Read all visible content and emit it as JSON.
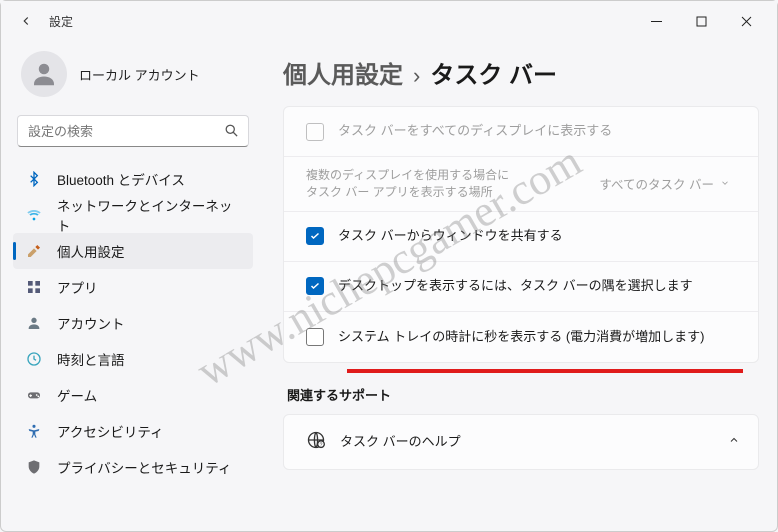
{
  "app_title": "設定",
  "account": {
    "name": "ローカル アカウント"
  },
  "search": {
    "placeholder": "設定の検索"
  },
  "sidebar": {
    "items": [
      {
        "label": "Bluetooth とデバイス",
        "icon": "bluetooth",
        "color": "#0067c0"
      },
      {
        "label": "ネットワークとインターネット",
        "icon": "wifi",
        "color": "#0aa2e3"
      },
      {
        "label": "個人用設定",
        "icon": "brush",
        "color": "#c55f1b",
        "active": true
      },
      {
        "label": "アプリ",
        "icon": "apps",
        "color": "#545a78"
      },
      {
        "label": "アカウント",
        "icon": "account",
        "color": "#6b7a85"
      },
      {
        "label": "時刻と言語",
        "icon": "clock-lang",
        "color": "#39a5bd"
      },
      {
        "label": "ゲーム",
        "icon": "game",
        "color": "#6e6e72"
      },
      {
        "label": "アクセシビリティ",
        "icon": "accessibility",
        "color": "#2f6db1"
      },
      {
        "label": "プライバシーとセキュリティ",
        "icon": "privacy",
        "color": "#6e6e72"
      }
    ]
  },
  "breadcrumb": {
    "parent": "個人用設定",
    "sep": "›",
    "current": "タスク バー"
  },
  "rows": {
    "show_all_displays": {
      "label": "タスク バーをすべてのディスプレイに表示する",
      "checked": false,
      "disabled": true
    },
    "multi_display": {
      "label_l1": "複数のディスプレイを使用する場合に",
      "label_l2": "タスク バー アプリを表示する場所",
      "select_value": "すべてのタスク バー",
      "disabled": true
    },
    "share_window": {
      "label": "タスク バーからウィンドウを共有する",
      "checked": true
    },
    "show_desktop_corner": {
      "label": "デスクトップを表示するには、タスク バーの隅を選択します",
      "checked": true
    },
    "seconds_clock": {
      "label": "システム トレイの時計に秒を表示する (電力消費が増加します)",
      "checked": false
    }
  },
  "related": {
    "heading": "関連するサポート",
    "help_label": "タスク バーのヘルプ"
  },
  "watermark": "www.nichepcgamer.com"
}
